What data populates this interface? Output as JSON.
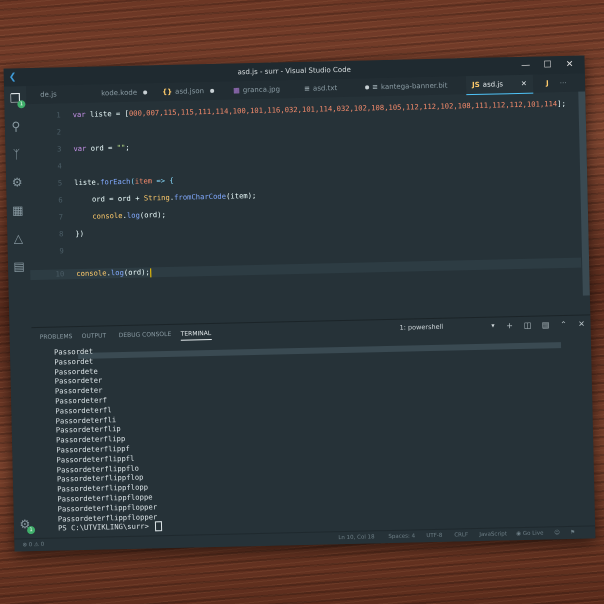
{
  "window": {
    "title": "asd.js - surr - Visual Studio Code",
    "controls": [
      "minimize",
      "maximize",
      "close"
    ]
  },
  "activity_bar": {
    "items": [
      "files-icon",
      "search-icon",
      "source-control-icon",
      "debug-icon",
      "extensions-icon",
      "test-icon",
      "remote-icon"
    ],
    "files_badge": "1",
    "settings_badge": "1"
  },
  "tabs": [
    {
      "label": "de.js",
      "icon": "",
      "active": false,
      "dirty": false
    },
    {
      "label": "kode.kode",
      "icon": "",
      "active": false,
      "dirty": true
    },
    {
      "label": "asd.json",
      "icon": "{}",
      "active": false,
      "dirty": true
    },
    {
      "label": "granca.jpg",
      "icon": "",
      "active": false,
      "dirty": false
    },
    {
      "label": "asd.txt",
      "icon": "",
      "active": false,
      "dirty": true
    },
    {
      "label": "kantega-banner.bit",
      "icon": "",
      "active": false,
      "dirty": false
    },
    {
      "label": "asd.js",
      "icon": "JS",
      "active": true,
      "dirty": false
    },
    {
      "label": "",
      "icon": "J",
      "active": false,
      "dirty": false
    }
  ],
  "editor": {
    "line_numbers": [
      "1",
      "2",
      "3",
      "4",
      "5",
      "6",
      "7",
      "8",
      "9",
      "10"
    ],
    "liste_values": "000,007,115,115,111,114,100,101,116,032,101,114,032,102,108,105,112,112,102,108,111,112,112,101,114",
    "lines": {
      "l1_kw": "var",
      "l1_name": " liste = [",
      "l1_end": "];",
      "l3_kw": "var",
      "l3_name": " ord = ",
      "l3_str": "\"\"",
      "l3_end": ";",
      "l5_a": "liste.",
      "l5_fn": "forEach",
      "l5_b": "(",
      "l5_c": "item",
      "l5_d": " => {",
      "l6_a": "    ord = ord + ",
      "l6_cls": "String",
      "l6_b": ".",
      "l6_fn": "fromCharCode",
      "l6_c": "(item);",
      "l7_a": "    ",
      "l7_obj": "console",
      "l7_b": ".",
      "l7_fn": "log",
      "l7_c": "(ord);",
      "l8": "})",
      "l10_obj": "console",
      "l10_b": ".",
      "l10_fn": "log",
      "l10_c": "(ord);"
    }
  },
  "panel": {
    "tabs": [
      "PROBLEMS",
      "OUTPUT",
      "DEBUG CONSOLE",
      "TERMINAL"
    ],
    "active_tab": "TERMINAL",
    "terminal_select": "1: powershell"
  },
  "terminal": {
    "lines": [
      "Passordet",
      "Passordet",
      "Passordete",
      "Passordeter",
      "Passordeter",
      "Passordeterf",
      "Passordeterfl",
      "Passordeterfli",
      "Passordeterflip",
      "Passordeterflipp",
      "Passordeterflippf",
      "Passordeterflippfl",
      "Passordeterflippflo",
      "Passordeterflippflop",
      "Passordeterflippflopp",
      "Passordeterflippfloppe",
      "Passordeterflippflopper",
      "Passordeterflippflopper"
    ],
    "prompt": "PS C:\\UTVIKLING\\surr> "
  },
  "status_bar": {
    "problems": "⊗ 0 ⚠ 0",
    "position": "Ln 10, Col 18",
    "spaces": "Spaces: 4",
    "encoding": "UTF-8",
    "eol": "CRLF",
    "language": "JavaScript",
    "golive": "Go Live"
  }
}
